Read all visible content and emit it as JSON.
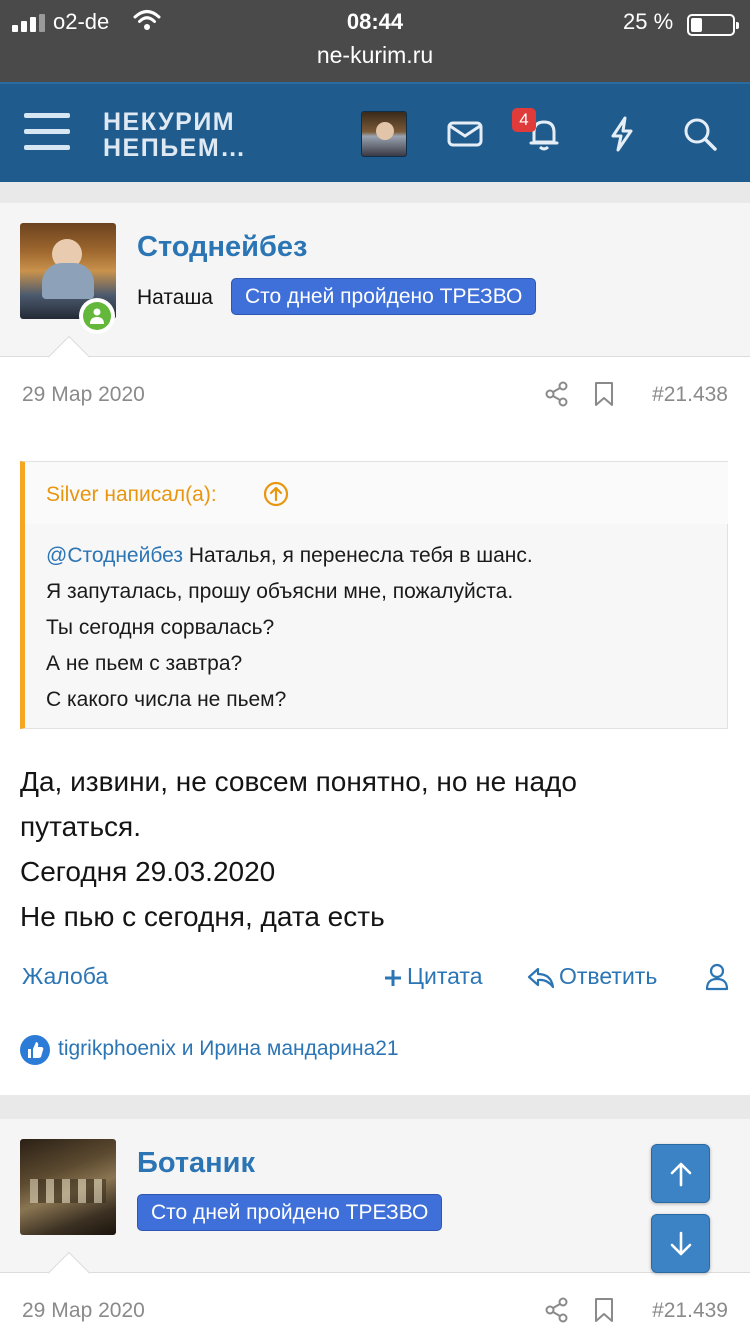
{
  "status_bar": {
    "carrier": "o2-de",
    "time": "08:44",
    "battery_percent": "25 %",
    "battery_level": 0.25,
    "url": "ne-kurim.ru"
  },
  "header": {
    "logo_line1": "НЕКУРИМ",
    "logo_line2": "НЕПЬЕМ…",
    "notifications_count": "4",
    "icons": [
      "menu-icon",
      "mail-icon",
      "bell-icon",
      "bolt-icon",
      "search-icon"
    ],
    "accent_color": "#1f5b8c"
  },
  "posts": [
    {
      "username": "Стоднейбез",
      "user_title": "Наташа",
      "banner": "Сто дней пройдено ТРЕЗВО",
      "date": "29 Мар 2020",
      "number": "#21.438",
      "quote": {
        "author": "Silver написал(а):",
        "mention": "@Стоднейбез",
        "lines": [
          "Наталья, я перенесла тебя в шанс.",
          "Я запуталась, прошу объясни мне, пожалуйста.",
          "Ты сегодня сорвалась?",
          "А не пьем с завтра?",
          "С какого числа не пьем?"
        ]
      },
      "message_lines": [
        "Да, извини, не совсем понятно, но не надо",
        "путаться.",
        "Сегодня 29.03.2020",
        "Не пью с сегодня, дата есть"
      ],
      "actions": {
        "report": "Жалоба",
        "quote": "Цитата",
        "reply": "Ответить"
      },
      "likes": "tigrikphoenix и Ирина мандарина21"
    },
    {
      "username": "Ботаник",
      "banner": "Сто дней пройдено ТРЕЗВО",
      "date": "29 Мар 2020",
      "number": "#21.439"
    }
  ],
  "colors": {
    "banner": "#3f6fd8",
    "link": "#2c75b4",
    "quote_accent": "#f5a623",
    "online": "#63b83b"
  }
}
